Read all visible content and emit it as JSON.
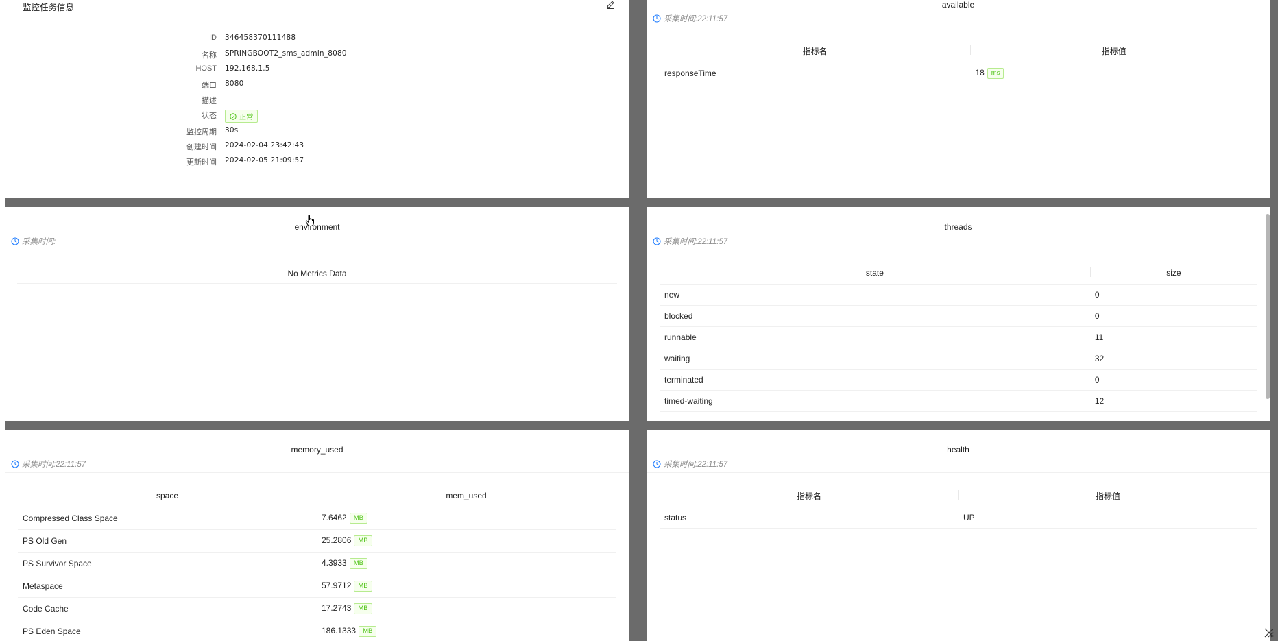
{
  "info_card": {
    "title": "监控任务信息",
    "fields": [
      {
        "key": "ID",
        "value": "346458370111488"
      },
      {
        "key": "名称",
        "value": "SPRINGBOOT2_sms_admin_8080"
      },
      {
        "key": "HOST",
        "value": "192.168.1.5"
      },
      {
        "key": "端口",
        "value": "8080"
      },
      {
        "key": "描述",
        "value": ""
      },
      {
        "key": "状态",
        "value": "正常"
      },
      {
        "key": "监控周期",
        "value": "30s"
      },
      {
        "key": "创建时间",
        "value": "2024-02-04 23:42:43"
      },
      {
        "key": "更新时间",
        "value": "2024-02-05 21:09:57"
      }
    ]
  },
  "available": {
    "title": "available",
    "collect_time": "采集时间:22:11:57",
    "columns": [
      "指标名",
      "指标值"
    ],
    "rows": [
      {
        "name": "responseTime",
        "value": "18",
        "unit": "ms"
      }
    ]
  },
  "environment": {
    "title": "environment",
    "collect_time": "采集时间:",
    "empty_text": "No Metrics Data"
  },
  "threads": {
    "title": "threads",
    "collect_time": "采集时间:22:11:57",
    "columns": [
      "state",
      "size"
    ],
    "rows": [
      {
        "state": "new",
        "size": "0"
      },
      {
        "state": "blocked",
        "size": "0"
      },
      {
        "state": "runnable",
        "size": "11"
      },
      {
        "state": "waiting",
        "size": "32"
      },
      {
        "state": "terminated",
        "size": "0"
      },
      {
        "state": "timed-waiting",
        "size": "12"
      }
    ]
  },
  "memory_used": {
    "title": "memory_used",
    "collect_time": "采集时间:22:11:57",
    "columns": [
      "space",
      "mem_used"
    ],
    "rows": [
      {
        "space": "Compressed Class Space",
        "value": "7.6462",
        "unit": "MB"
      },
      {
        "space": "PS Old Gen",
        "value": "25.2806",
        "unit": "MB"
      },
      {
        "space": "PS Survivor Space",
        "value": "4.3933",
        "unit": "MB"
      },
      {
        "space": "Metaspace",
        "value": "57.9712",
        "unit": "MB"
      },
      {
        "space": "Code Cache",
        "value": "17.2743",
        "unit": "MB"
      },
      {
        "space": "PS Eden Space",
        "value": "186.1333",
        "unit": "MB"
      }
    ]
  },
  "health": {
    "title": "health",
    "collect_time": "采集时间:22:11:57",
    "columns": [
      "指标名",
      "指标值"
    ],
    "rows": [
      {
        "name": "status",
        "value": "UP"
      }
    ]
  },
  "colors": {
    "gutter": "#6b6b6b",
    "accent": "#1677ff",
    "success": "#52c41a"
  }
}
